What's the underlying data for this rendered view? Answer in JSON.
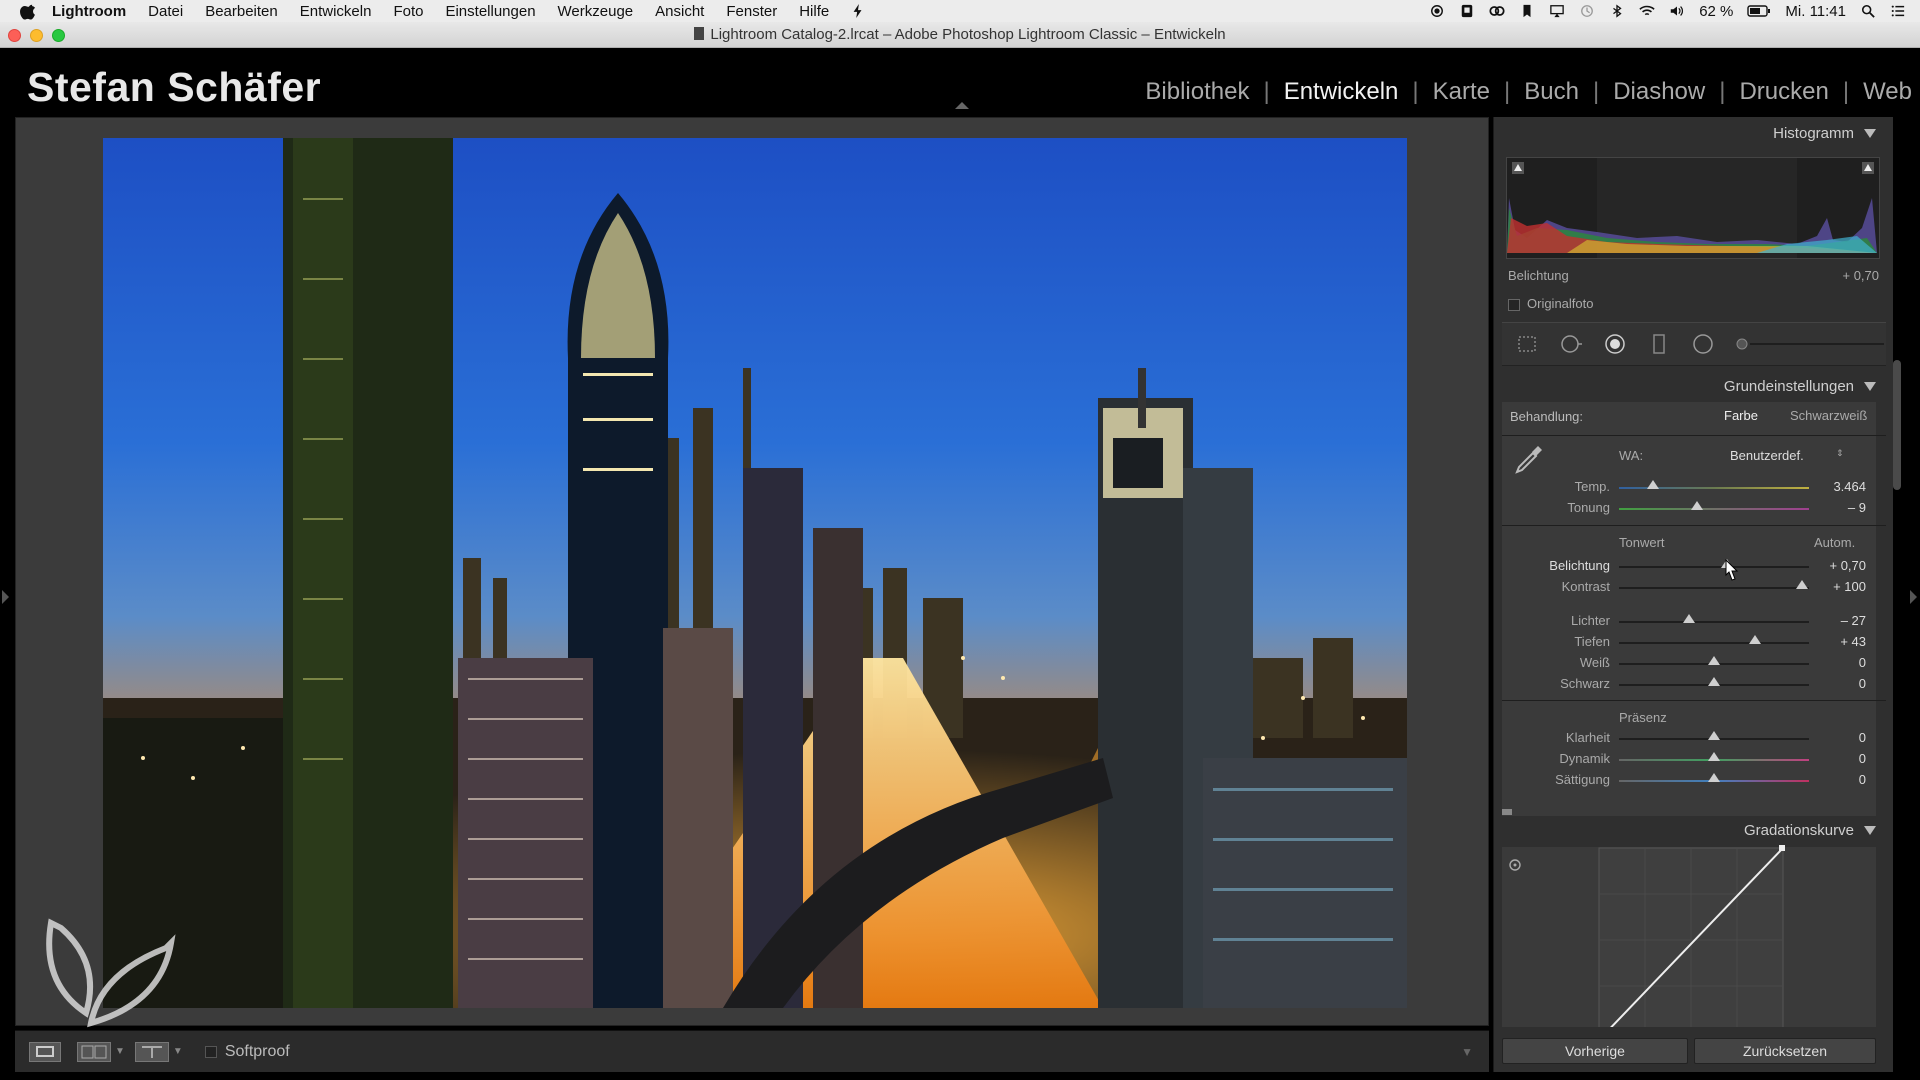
{
  "menubar": {
    "app": "Lightroom",
    "items": [
      "Datei",
      "Bearbeiten",
      "Entwickeln",
      "Foto",
      "Einstellungen",
      "Werkzeuge",
      "Ansicht",
      "Fenster",
      "Hilfe"
    ],
    "battery": "62 %",
    "clock": "Mi. 11:41"
  },
  "window": {
    "title": "Lightroom Catalog-2.lrcat – Adobe Photoshop Lightroom Classic – Entwickeln"
  },
  "identity": "Stefan Schäfer",
  "modules": [
    {
      "label": "Bibliothek"
    },
    {
      "label": "Entwickeln"
    },
    {
      "label": "Karte"
    },
    {
      "label": "Buch"
    },
    {
      "label": "Diashow"
    },
    {
      "label": "Drucken"
    },
    {
      "label": "Web"
    }
  ],
  "toolbar": {
    "softproof": "Softproof"
  },
  "panels": {
    "histogram": {
      "title": "Histogramm",
      "readout_label": "Belichtung",
      "readout_value": "+ 0,70",
      "original_photo": "Originalfoto"
    },
    "basic": {
      "title": "Grundeinstellungen",
      "treatment_label": "Behandlung:",
      "treatment_color": "Farbe",
      "treatment_bw": "Schwarzweiß",
      "wb_label": "WA:",
      "wb_value": "Benutzerdef.",
      "temp_label": "Temp.",
      "temp_value": "3.464",
      "tint_label": "Tonung",
      "tint_value": "– 9",
      "tone_label": "Tonwert",
      "auto_label": "Autom.",
      "exposure_label": "Belichtung",
      "exposure_value": "+ 0,70",
      "contrast_label": "Kontrast",
      "contrast_value": "+ 100",
      "highlights_label": "Lichter",
      "highlights_value": "– 27",
      "shadows_label": "Tiefen",
      "shadows_value": "+ 43",
      "whites_label": "Weiß",
      "whites_value": "0",
      "blacks_label": "Schwarz",
      "blacks_value": "0",
      "presence_label": "Präsenz",
      "clarity_label": "Klarheit",
      "clarity_value": "0",
      "vibrance_label": "Dynamik",
      "vibrance_value": "0",
      "saturation_label": "Sättigung",
      "saturation_value": "0"
    },
    "tone_curve": {
      "title": "Gradationskurve"
    }
  },
  "buttons": {
    "previous": "Vorherige",
    "reset": "Zurücksetzen"
  }
}
